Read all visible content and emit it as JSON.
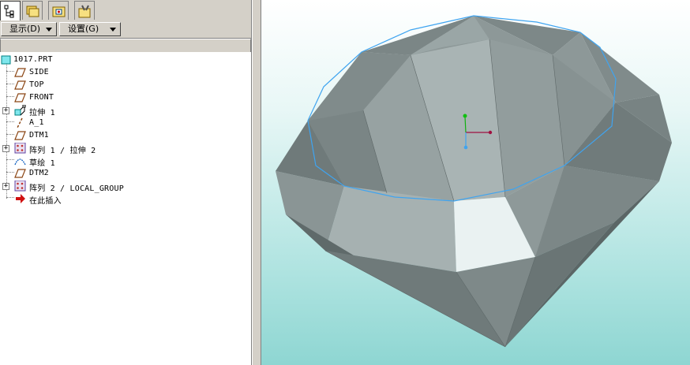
{
  "toolbar": {
    "display_label": "显示(D)",
    "settings_label": "设置(G)"
  },
  "model_tree": {
    "items": [
      {
        "label": "1017.PRT",
        "icon": "part-icon"
      },
      {
        "label": "SIDE",
        "icon": "datum-plane-icon"
      },
      {
        "label": "TOP",
        "icon": "datum-plane-icon"
      },
      {
        "label": "FRONT",
        "icon": "datum-plane-icon"
      },
      {
        "label": "拉伸 1",
        "icon": "extrude-icon"
      },
      {
        "label": "A_1",
        "icon": "datum-axis-icon"
      },
      {
        "label": "DTM1",
        "icon": "datum-plane-icon"
      },
      {
        "label": "阵列 1 / 拉伸 2",
        "icon": "pattern-icon"
      },
      {
        "label": "草绘 1",
        "icon": "sketch-icon"
      },
      {
        "label": "DTM2",
        "icon": "datum-plane-icon"
      },
      {
        "label": "阵列 2 / LOCAL_GROUP",
        "icon": "pattern-icon"
      },
      {
        "label": "在此插入",
        "icon": "insert-here-arrow-icon"
      }
    ]
  },
  "viewport": {
    "background_top": "#ffffff",
    "background_bottom": "#8ed6d2",
    "model_color": "#8a9494",
    "sketch_color": "#3fa4f0"
  }
}
